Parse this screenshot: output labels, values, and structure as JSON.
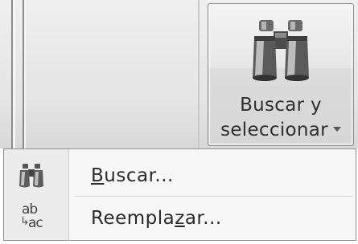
{
  "ribbon": {
    "find_select_button": {
      "label_line1": "Buscar y",
      "label_line2": "seleccionar",
      "icon": "binoculars-icon"
    }
  },
  "menu": {
    "items": [
      {
        "label_accel": "B",
        "label_rest": "uscar...",
        "icon": "binoculars-icon"
      },
      {
        "label_pre": "Reempla",
        "label_accel": "z",
        "label_post": "ar...",
        "icon": "replace-ab-ac-icon"
      }
    ]
  }
}
